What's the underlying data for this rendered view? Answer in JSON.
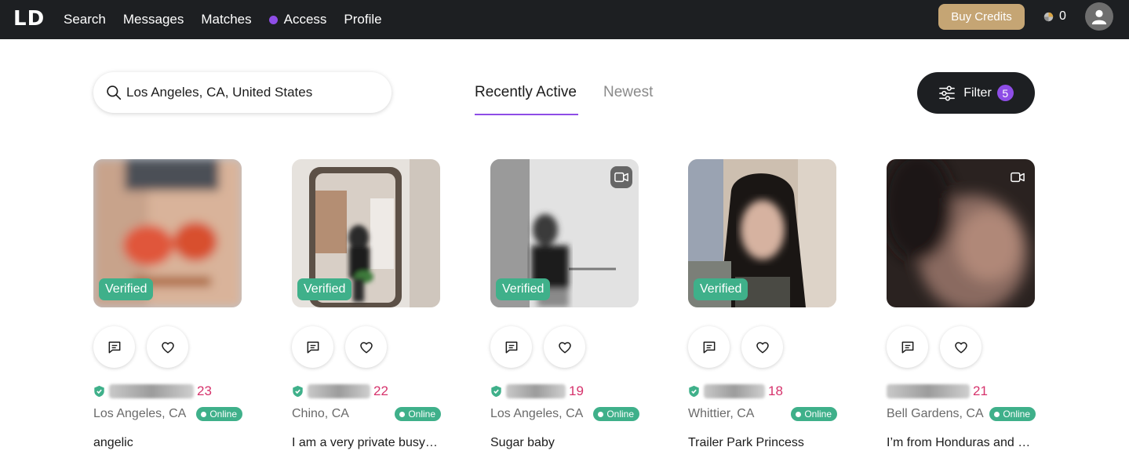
{
  "nav": {
    "logo": "LD",
    "items": [
      "Search",
      "Messages",
      "Matches",
      "Access",
      "Profile"
    ],
    "access_dot_color": "#8e4de6",
    "buy_credits": "Buy Credits",
    "credits": "0"
  },
  "search": {
    "value": "Los Angeles, CA, United States"
  },
  "tabs": {
    "active": "Recently Active",
    "inactive": "Newest"
  },
  "filter": {
    "label": "Filter",
    "count": "5"
  },
  "colors": {
    "accent": "#8e4de6",
    "verified": "#3fb08a",
    "age": "#d6336c",
    "gold": "#c5a574"
  },
  "cards": [
    {
      "verified_tag": "Verified",
      "age": "23",
      "location": "Los Angeles, CA",
      "status": "Online",
      "bio": "angelic",
      "has_video": false
    },
    {
      "verified_tag": "Verified",
      "age": "22",
      "location": "Chino, CA",
      "status": "Online",
      "bio": "I am a very private busy person",
      "has_video": false
    },
    {
      "verified_tag": "Verified",
      "age": "19",
      "location": "Los Angeles, CA",
      "status": "Online",
      "bio": "Sugar baby",
      "has_video": true
    },
    {
      "verified_tag": "Verified",
      "age": "18",
      "location": "Whittier, CA",
      "status": "Online",
      "bio": "Trailer Park Princess",
      "has_video": false
    },
    {
      "verified_tag": "",
      "age": "21",
      "location": "Bell Gardens, CA",
      "status": "Online",
      "bio": "I’m from Honduras and California",
      "has_video": true
    }
  ]
}
